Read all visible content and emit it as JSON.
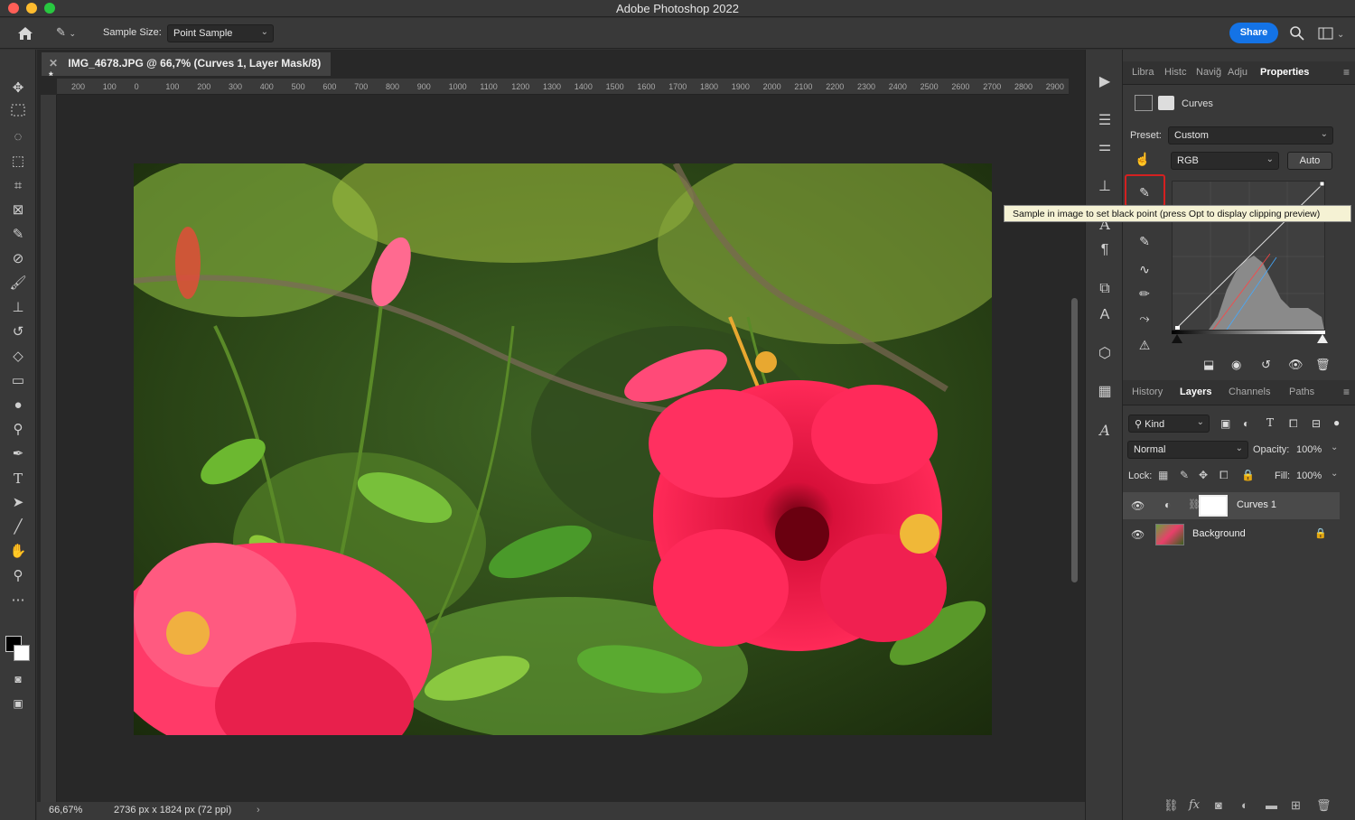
{
  "window": {
    "title": "Adobe Photoshop 2022"
  },
  "options": {
    "sample_size_label": "Sample Size:",
    "sample_size_value": "Point Sample",
    "share_label": "Share"
  },
  "document": {
    "tab_title": "IMG_4678.JPG @ 66,7% (Curves 1, Layer Mask/8) *",
    "ruler_ticks": [
      "200",
      "100",
      "0",
      "100",
      "200",
      "300",
      "400",
      "500",
      "600",
      "700",
      "800",
      "900",
      "1000",
      "1100",
      "1200",
      "1300",
      "1400",
      "1500",
      "1600",
      "1700",
      "1800",
      "1900",
      "2000",
      "2100",
      "2200",
      "2300",
      "2400",
      "2500",
      "2600",
      "2700",
      "2800",
      "2900"
    ],
    "zoom": "66,67%",
    "dimensions": "2736 px x 1824 px (72 ppi)"
  },
  "panel_tabs": [
    "Libra",
    "Histc",
    "Naviğ",
    "Adju",
    "Properties"
  ],
  "properties": {
    "adjustment_name": "Curves",
    "preset_label": "Preset:",
    "preset_value": "Custom",
    "channel_value": "RGB",
    "auto_label": "Auto",
    "tooltip": "Sample in image to set black point (press Opt to display clipping preview)"
  },
  "layers_tabs": [
    "History",
    "Layers",
    "Channels",
    "Paths"
  ],
  "layers": {
    "kind_label": "Kind",
    "blend_mode": "Normal",
    "opacity_label": "Opacity:",
    "opacity_value": "100%",
    "lock_label": "Lock:",
    "fill_label": "Fill:",
    "fill_value": "100%",
    "items": [
      {
        "name": "Curves 1"
      },
      {
        "name": "Background"
      }
    ]
  },
  "colors": {
    "accent": "#1473e6",
    "highlight": "#d42020"
  }
}
